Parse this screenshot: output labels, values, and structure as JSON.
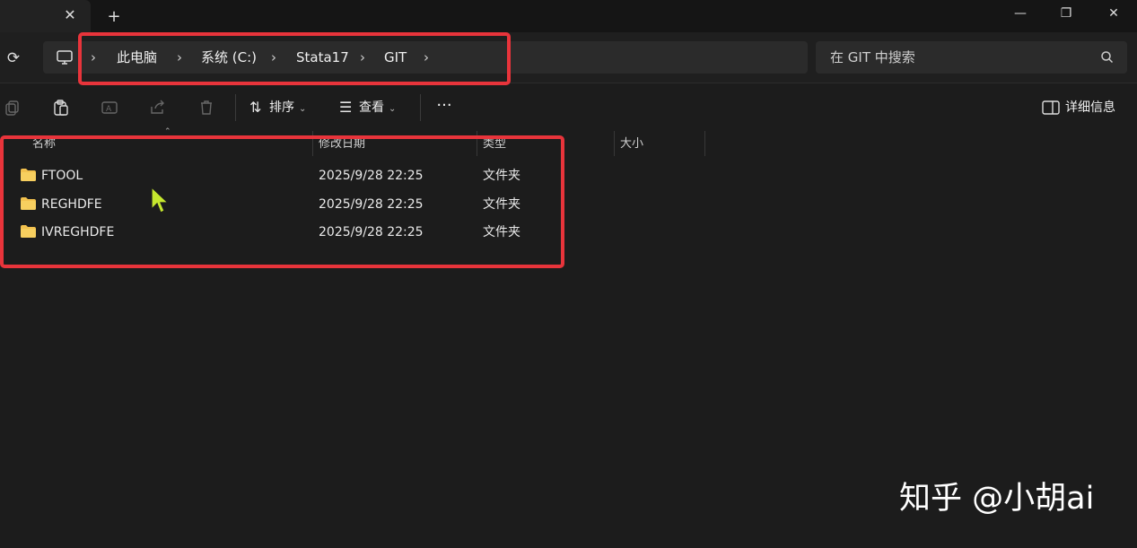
{
  "titlebar": {
    "tab_close": "✕",
    "tab_add": "+",
    "minimize": "—",
    "maximize": "❐",
    "close": "✕"
  },
  "address": {
    "breadcrumb": [
      "此电脑",
      "系统 (C:)",
      "Stata17",
      "GIT"
    ],
    "separator": "›"
  },
  "search": {
    "placeholder": "在 GIT 中搜索"
  },
  "toolbar": {
    "sort_label": "排序",
    "view_label": "查看",
    "more_label": "···",
    "details_label": "详细信息"
  },
  "list": {
    "columns": [
      "名称",
      "修改日期",
      "类型",
      "大小"
    ],
    "rows": [
      {
        "name": "FTOOL",
        "modified": "2025/9/28 22:25",
        "type": "文件夹"
      },
      {
        "name": "REGHDFE",
        "modified": "2025/9/28 22:25",
        "type": "文件夹"
      },
      {
        "name": "IVREGHDFE",
        "modified": "2025/9/28 22:25",
        "type": "文件夹"
      }
    ]
  },
  "watermark": "知乎 @小胡ai",
  "colors": {
    "accent_annotation": "#e8343b",
    "folder": "#f2c14e",
    "cursor": "#c6e82e"
  }
}
